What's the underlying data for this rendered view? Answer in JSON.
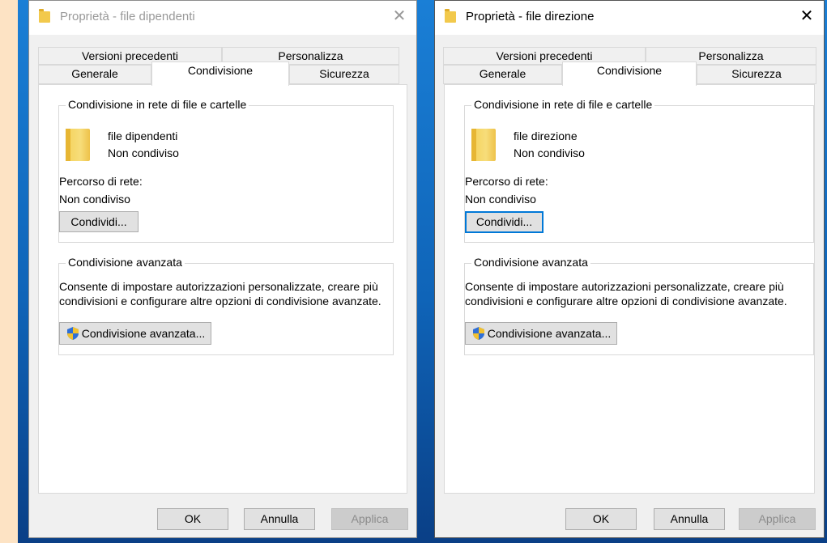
{
  "left_window": {
    "title": "Proprietà - file dipendenti",
    "tabs": [
      "Versioni precedenti",
      "Personalizza",
      "Generale",
      "Condivisione",
      "Sicurezza"
    ],
    "selected_tab": "Condivisione",
    "network_group_label": "Condivisione in rete di file e cartelle",
    "folder_name": "file dipendenti",
    "folder_status": "Non condiviso",
    "network_path_label": "Percorso di rete:",
    "network_path_value": "Non condiviso",
    "share_button": "Condividi...",
    "advanced_group_label": "Condivisione avanzata",
    "advanced_description_line1": "Consente di impostare autorizzazioni personalizzate, creare più",
    "advanced_description_line2": "condivisioni e configurare altre opzioni di condivisione avanzate.",
    "advanced_button": "Condivisione avanzata...",
    "ok_button": "OK",
    "cancel_button": "Annulla",
    "apply_button": "Applica"
  },
  "right_window": {
    "title": "Proprietà - file direzione",
    "tabs": [
      "Versioni precedenti",
      "Personalizza",
      "Generale",
      "Condivisione",
      "Sicurezza"
    ],
    "selected_tab": "Condivisione",
    "network_group_label": "Condivisione in rete di file e cartelle",
    "folder_name": "file direzione",
    "folder_status": "Non condiviso",
    "network_path_label": "Percorso di rete:",
    "network_path_value": "Non condiviso",
    "share_button": "Condividi...",
    "advanced_group_label": "Condivisione avanzata",
    "advanced_description_line1": "Consente di impostare autorizzazioni personalizzate, creare più",
    "advanced_description_line2": "condivisioni e configurare altre opzioni di condivisione avanzate.",
    "advanced_button": "Condivisione avanzata...",
    "ok_button": "OK",
    "cancel_button": "Annulla",
    "apply_button": "Applica"
  },
  "icons": {
    "title_folder": "folder-icon",
    "close": "close-icon",
    "folder_large": "folder-icon",
    "uac_shield": "uac-shield-icon"
  },
  "colors": {
    "focus_border": "#0078d7",
    "folder_yellow": "#f5d25a",
    "desktop_blue": "#0f64b8"
  }
}
